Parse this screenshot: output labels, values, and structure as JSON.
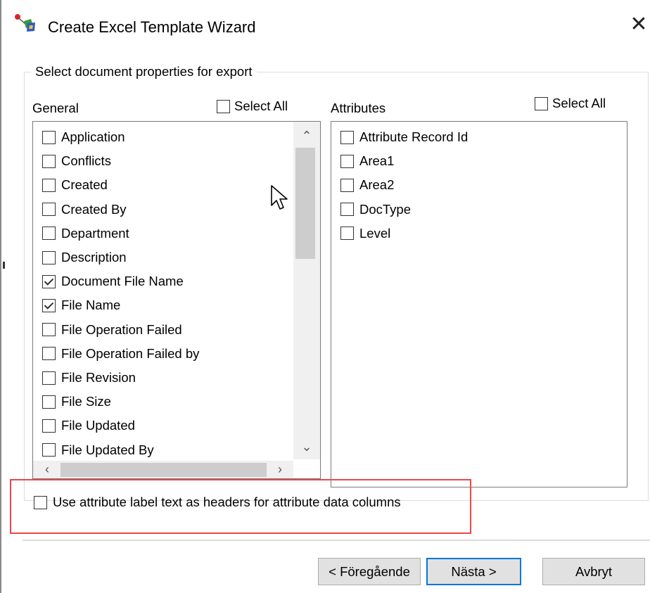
{
  "window": {
    "title": "Create Excel Template Wizard",
    "close_glyph": "✕",
    "icon": "wizard-app-icon"
  },
  "group": {
    "legend": "Select document properties for export"
  },
  "general": {
    "label": "General",
    "select_all_label": "Select All",
    "select_all_checked": false,
    "items": [
      {
        "label": "Application",
        "checked": false
      },
      {
        "label": "Conflicts",
        "checked": false
      },
      {
        "label": "Created",
        "checked": false
      },
      {
        "label": "Created By",
        "checked": false
      },
      {
        "label": "Department",
        "checked": false
      },
      {
        "label": "Description",
        "checked": false
      },
      {
        "label": "Document File Name",
        "checked": true
      },
      {
        "label": "File Name",
        "checked": true
      },
      {
        "label": "File Operation Failed",
        "checked": false
      },
      {
        "label": "File Operation Failed by",
        "checked": false
      },
      {
        "label": "File Revision",
        "checked": false
      },
      {
        "label": "File Size",
        "checked": false
      },
      {
        "label": "File Updated",
        "checked": false
      },
      {
        "label": "File Updated By",
        "checked": false
      }
    ]
  },
  "attributes": {
    "label": "Attributes",
    "select_all_label": "Select All",
    "select_all_checked": false,
    "items": [
      {
        "label": "Attribute Record Id",
        "checked": false
      },
      {
        "label": "Area1",
        "checked": false
      },
      {
        "label": "Area2",
        "checked": false
      },
      {
        "label": "DocType",
        "checked": false
      },
      {
        "label": "Level",
        "checked": false
      }
    ]
  },
  "option": {
    "label": "Use attribute label text as headers for attribute data columns",
    "checked": false
  },
  "buttons": {
    "previous": "< Föregående",
    "next": "Nästa >",
    "cancel": "Avbryt"
  },
  "scroll_glyphs": {
    "up": "⌃",
    "down": "⌄",
    "left": "‹",
    "right": "›"
  },
  "colors": {
    "highlight": "#e8474a",
    "default_button_border": "#0078d7"
  }
}
